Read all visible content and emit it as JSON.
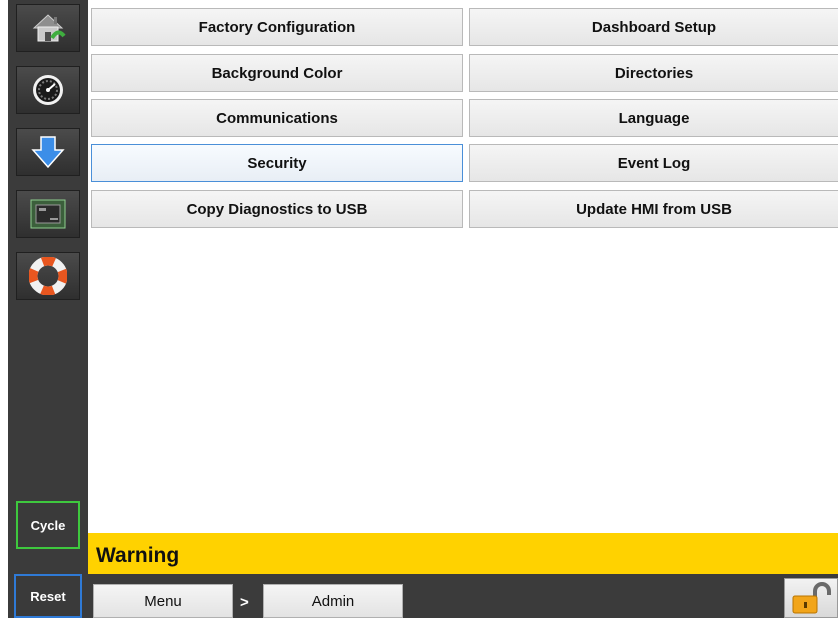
{
  "sidebar": {
    "items": [
      {
        "icon": "home-icon"
      },
      {
        "icon": "dashboard-gauge-icon"
      },
      {
        "icon": "download-arrow-icon"
      },
      {
        "icon": "cpu-board-icon"
      },
      {
        "icon": "lifebuoy-icon"
      }
    ],
    "cycle_label": "Cycle",
    "reset_label": "Reset"
  },
  "menu": {
    "buttons": [
      {
        "label": "Factory Configuration"
      },
      {
        "label": "Dashboard Setup"
      },
      {
        "label": "Background Color"
      },
      {
        "label": "Directories"
      },
      {
        "label": "Communications"
      },
      {
        "label": "Language"
      },
      {
        "label": "Security",
        "selected": true
      },
      {
        "label": "Event Log"
      },
      {
        "label": "Copy Diagnostics to USB"
      },
      {
        "label": "Update HMI from USB"
      }
    ]
  },
  "warning": {
    "text": "Warning",
    "color": "#ffd200"
  },
  "breadcrumb": {
    "items": [
      "Menu",
      "Admin"
    ],
    "separator": ">"
  },
  "lock": {
    "icon": "unlocked-padlock-icon",
    "color": "#f2a51a"
  },
  "colors": {
    "sidebar_bg": "#3b3b3b",
    "cycle_border": "#3ec83e",
    "reset_border": "#2f7ad6",
    "selected_border": "#4a8fd8"
  }
}
